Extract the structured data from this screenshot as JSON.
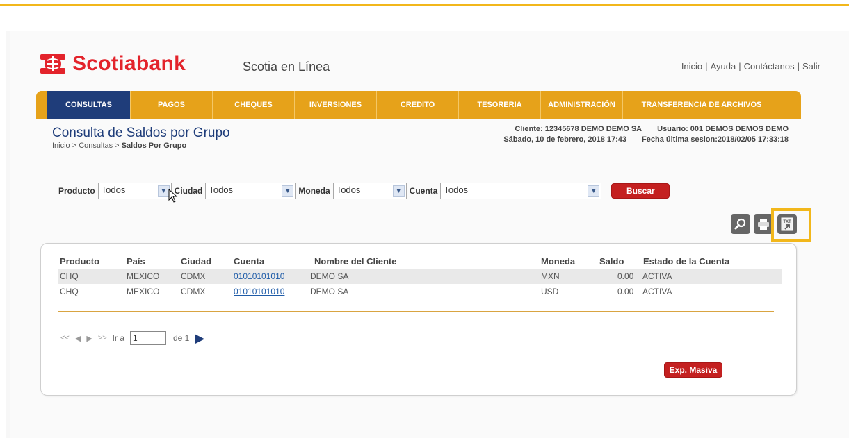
{
  "brand": {
    "name": "Scotiabank",
    "product": "Scotia en Línea",
    "accent_color": "#e3232b",
    "nav_color": "#e6a21a",
    "nav_active_color": "#1f3d7a"
  },
  "top_links": [
    "Inicio",
    "Ayuda",
    "Contáctanos",
    "Salir"
  ],
  "nav": [
    {
      "label": "CONSULTAS",
      "active": true
    },
    {
      "label": "PAGOS",
      "active": false
    },
    {
      "label": "CHEQUES",
      "active": false
    },
    {
      "label": "INVERSIONES",
      "active": false
    },
    {
      "label": "CREDITO",
      "active": false
    },
    {
      "label": "TESORERIA",
      "active": false
    },
    {
      "label": "ADMINISTRACIÓN",
      "active": false
    },
    {
      "label": "TRANSFERENCIA DE ARCHIVOS",
      "active": false
    }
  ],
  "page": {
    "title": "Consulta de Saldos por Grupo",
    "breadcrumb_prefix": "Inicio > Consultas > ",
    "breadcrumb_current": "Saldos Por Grupo"
  },
  "client_info": {
    "client": "Cliente: 12345678 DEMO DEMO SA",
    "user": "Usuario: 001 DEMOS DEMOS DEMO",
    "date": "Sábado, 10 de febrero, 2018 17:43",
    "last_session": "Fecha última sesion:2018/02/05 17:33:18"
  },
  "filters": {
    "producto_label": "Producto",
    "producto_value": "Todos",
    "ciudad_label": "Ciudad",
    "ciudad_value": "Todos",
    "moneda_label": "Moneda",
    "moneda_value": "Todos",
    "cuenta_label": "Cuenta",
    "cuenta_value": "Todos",
    "search_button": "Buscar"
  },
  "toolbar": {
    "search_icon": "magnifier-icon",
    "print_icon": "printer-icon",
    "txt_icon": "txt-export-icon",
    "txt_label": "TXT"
  },
  "table": {
    "headers": [
      "Producto",
      "País",
      "Ciudad",
      "Cuenta",
      "Nombre del Cliente",
      "Moneda",
      "Saldo",
      "Estado de la Cuenta"
    ],
    "rows": [
      [
        "CHQ",
        "MEXICO",
        "CDMX",
        "01010101010",
        "DEMO SA",
        "MXN",
        "0.00",
        "ACTIVA"
      ],
      [
        "CHQ",
        "MEXICO",
        "CDMX",
        "01010101010",
        "DEMO SA",
        "USD",
        "0.00",
        "ACTIVA"
      ]
    ]
  },
  "pager": {
    "go_to_label": "Ir a",
    "page_value": "1",
    "of_label": "de 1"
  },
  "export_button": "Exp. Masiva"
}
